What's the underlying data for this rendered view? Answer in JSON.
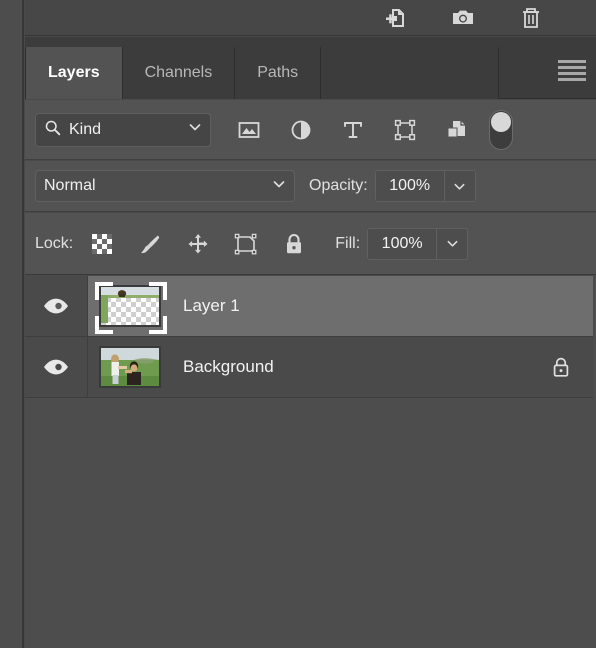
{
  "toolbar": {
    "icons": [
      {
        "name": "new-document-icon",
        "label": "Create new document"
      },
      {
        "name": "camera-icon",
        "label": "Create new snapshot"
      },
      {
        "name": "trash-icon",
        "label": "Delete"
      }
    ]
  },
  "tabs": [
    {
      "label": "Layers",
      "active": true
    },
    {
      "label": "Channels",
      "active": false
    },
    {
      "label": "Paths",
      "active": false
    }
  ],
  "panel_menu": {
    "name": "panel-menu-icon",
    "label": "Panel menu"
  },
  "filter": {
    "kind_label": "Kind",
    "search_icon": "search-icon",
    "chevron_icon": "chevron-down-icon",
    "type_icons": [
      {
        "name": "pixel-layer-filter-icon",
        "label": "Filter for pixel layers"
      },
      {
        "name": "adjustment-layer-filter-icon",
        "label": "Filter for adjustment layers"
      },
      {
        "name": "type-layer-filter-icon",
        "label": "Filter for type layers"
      },
      {
        "name": "shape-layer-filter-icon",
        "label": "Filter for shape layers"
      },
      {
        "name": "smart-object-filter-icon",
        "label": "Filter for smart objects"
      }
    ],
    "toggle": {
      "name": "filter-toggle-switch",
      "state": "on"
    }
  },
  "blend": {
    "mode": "Normal",
    "opacity_caption": "Opacity:",
    "opacity_value": "100%"
  },
  "lock": {
    "caption": "Lock:",
    "icons": [
      {
        "name": "lock-transparent-pixels-icon",
        "label": "Lock transparent pixels"
      },
      {
        "name": "lock-image-pixels-icon",
        "label": "Lock image pixels"
      },
      {
        "name": "lock-position-icon",
        "label": "Lock position"
      },
      {
        "name": "lock-artboard-nesting-icon",
        "label": "Prevent auto-nesting"
      },
      {
        "name": "lock-all-icon",
        "label": "Lock all"
      }
    ],
    "fill_caption": "Fill:",
    "fill_value": "100%"
  },
  "layers": [
    {
      "name": "Layer 1",
      "visible": true,
      "selected": true,
      "locked": false,
      "thumbnail": "transparent-with-sky-and-head"
    },
    {
      "name": "Background",
      "visible": true,
      "selected": false,
      "locked": true,
      "thumbnail": "photo-two-people-in-green-field"
    }
  ],
  "colors": {
    "panel_bg": "#4a4a4a",
    "row_selected": "#6e6e6e",
    "control_bg": "#535353",
    "tab_active": "#535353",
    "tab_inactive": "#3c3c3c",
    "text": "#f0f0f0",
    "icon": "#d0d0d0"
  }
}
